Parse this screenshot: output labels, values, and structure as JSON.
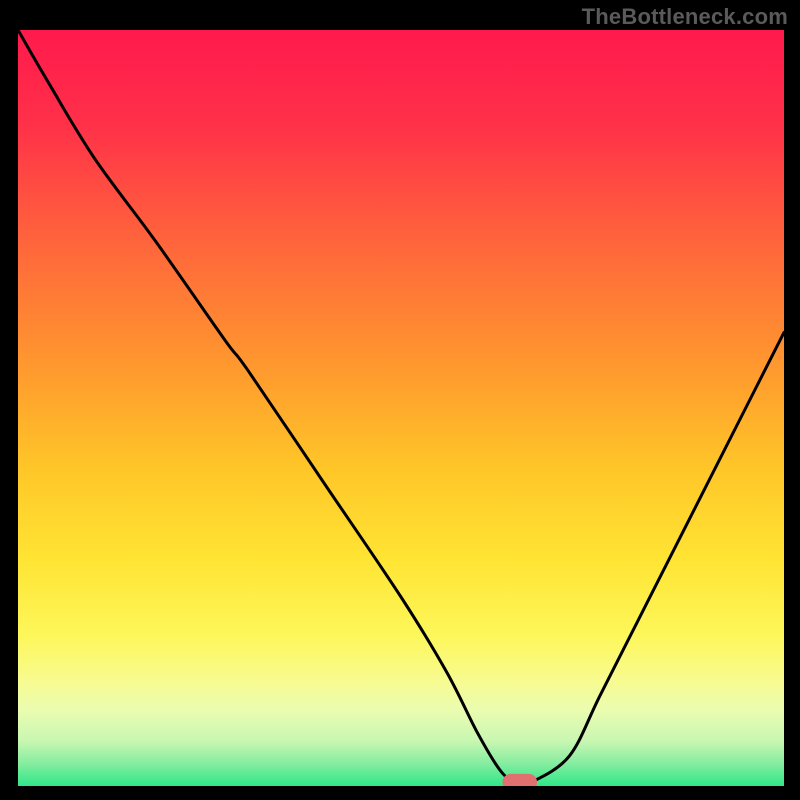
{
  "watermark": "TheBottleneck.com",
  "chart_data": {
    "type": "line",
    "title": "",
    "xlabel": "",
    "ylabel": "",
    "xlim": [
      0,
      100
    ],
    "ylim": [
      0,
      100
    ],
    "grid": false,
    "background": {
      "description": "vertical gradient from red (top) through orange/yellow to green (bottom)",
      "stops": [
        {
          "pos": 0.0,
          "color": "#ff1a4d"
        },
        {
          "pos": 0.12,
          "color": "#ff2f49"
        },
        {
          "pos": 0.3,
          "color": "#ff6b3a"
        },
        {
          "pos": 0.45,
          "color": "#ff9a2e"
        },
        {
          "pos": 0.58,
          "color": "#ffc628"
        },
        {
          "pos": 0.7,
          "color": "#ffe433"
        },
        {
          "pos": 0.8,
          "color": "#fdf75a"
        },
        {
          "pos": 0.86,
          "color": "#f8fb8f"
        },
        {
          "pos": 0.9,
          "color": "#eafcb0"
        },
        {
          "pos": 0.94,
          "color": "#c9f7b2"
        },
        {
          "pos": 0.97,
          "color": "#86eda0"
        },
        {
          "pos": 1.0,
          "color": "#2fe788"
        }
      ]
    },
    "series": [
      {
        "name": "bottleneck-curve",
        "color": "#000000",
        "x": [
          0,
          4,
          10,
          18,
          27,
          30,
          40,
          50,
          56,
          60,
          63,
          65,
          67,
          72,
          76,
          82,
          90,
          96,
          100
        ],
        "y": [
          100,
          93,
          83,
          72,
          59,
          55,
          40,
          25,
          15,
          7,
          2,
          0.5,
          0.5,
          4,
          12,
          24,
          40,
          52,
          60
        ]
      }
    ],
    "marker": {
      "name": "optimal-marker",
      "x": 65.5,
      "y": 0.5,
      "width_x": 4.5,
      "height_y": 2.2,
      "color": "#e17070"
    }
  }
}
